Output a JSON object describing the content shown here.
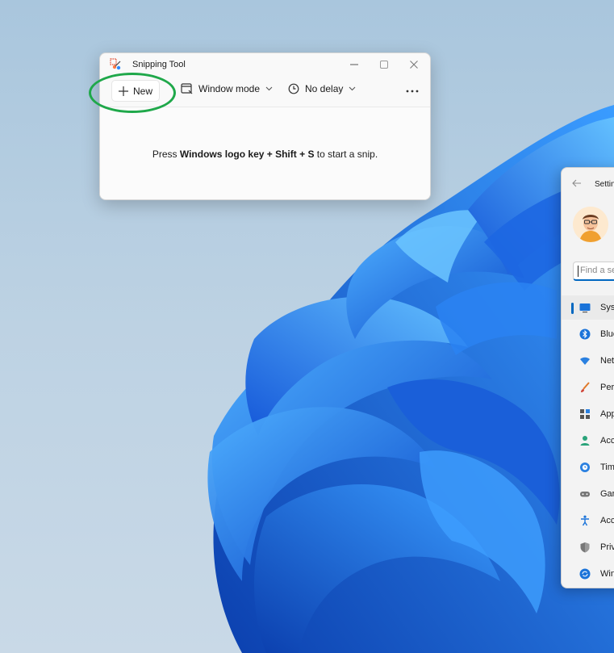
{
  "snipping_tool": {
    "title": "Snipping Tool",
    "toolbar": {
      "new_label": "New",
      "mode_label": "Window mode",
      "delay_label": "No delay"
    },
    "hint": {
      "prefix": "Press ",
      "keys": "Windows logo key + Shift + S",
      "suffix": " to start a snip."
    }
  },
  "settings": {
    "title": "Settin",
    "search_placeholder": "Find a se",
    "nav": [
      {
        "label": "Syst",
        "icon": "display-icon"
      },
      {
        "label": "Blue",
        "icon": "bluetooth-icon"
      },
      {
        "label": "Net",
        "icon": "wifi-icon"
      },
      {
        "label": "Pers",
        "icon": "brush-icon"
      },
      {
        "label": "App",
        "icon": "apps-icon"
      },
      {
        "label": "Acc",
        "icon": "person-icon"
      },
      {
        "label": "Tim",
        "icon": "clock-globe-icon"
      },
      {
        "label": "Gar",
        "icon": "gamepad-icon"
      },
      {
        "label": "Acc",
        "icon": "accessibility-icon"
      },
      {
        "label": "Priv",
        "icon": "shield-icon"
      },
      {
        "label": "Win",
        "icon": "update-icon"
      }
    ]
  },
  "colors": {
    "accent": "#0067c0",
    "annotation": "#1fa84a",
    "wallpaper_bloom": "#1f73e6"
  }
}
